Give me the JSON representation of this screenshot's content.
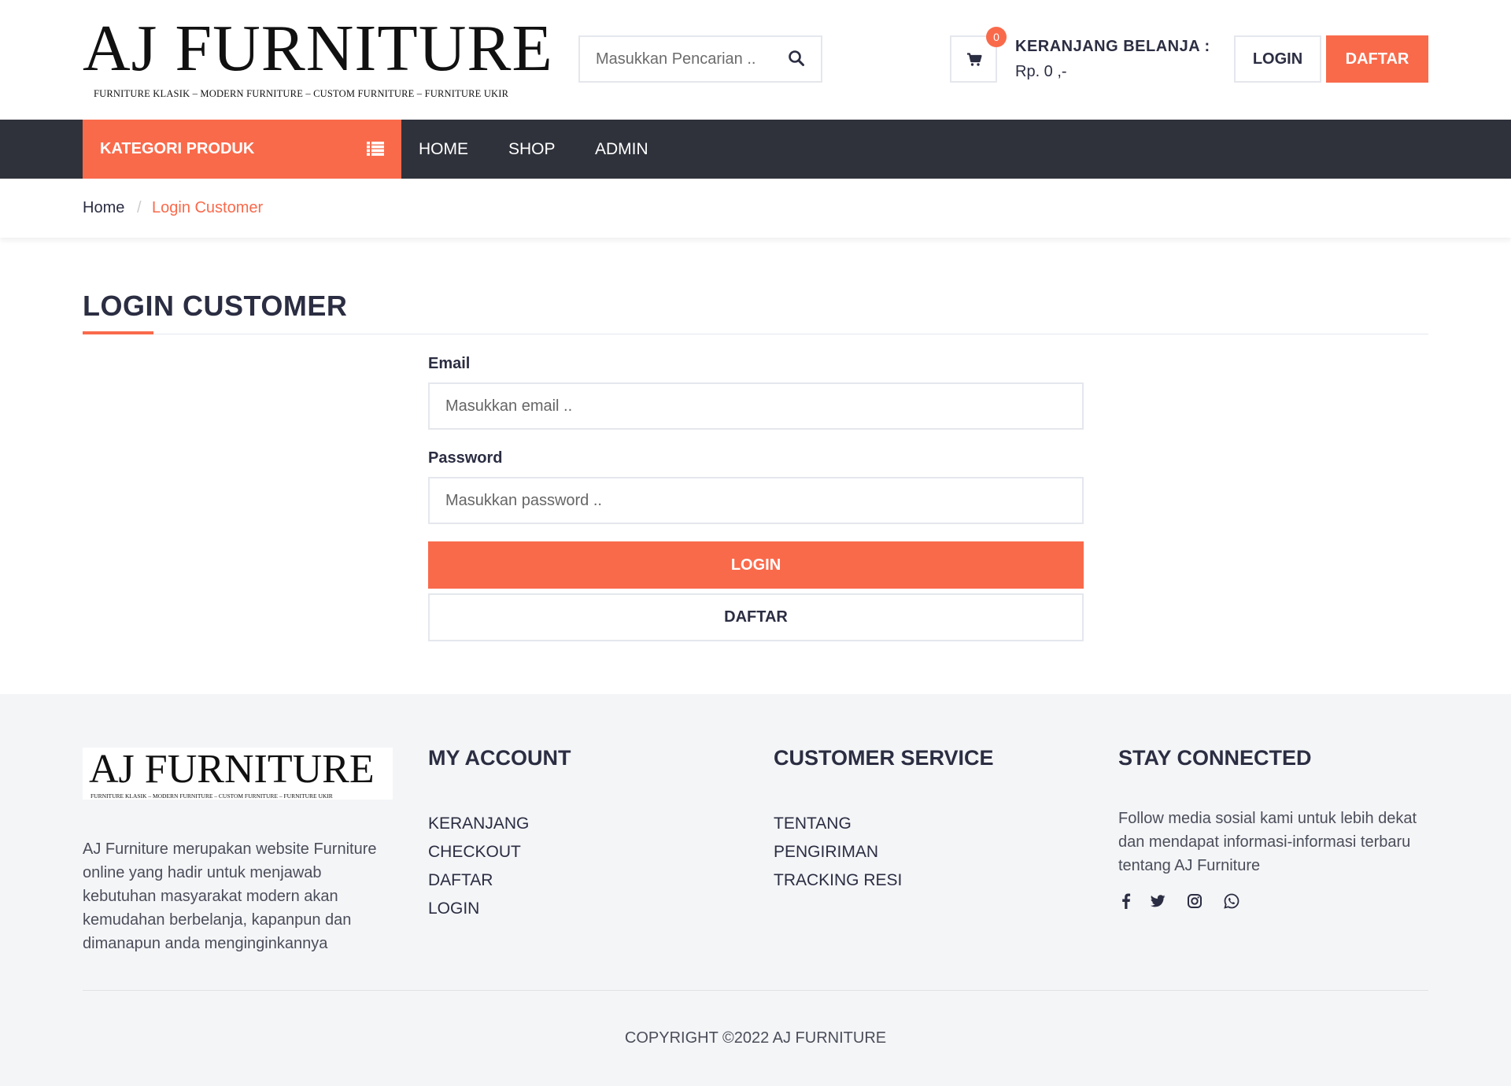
{
  "brand": {
    "name": "AJ FURNITURE",
    "tagline": "FURNITURE KLASIK – MODERN FURNITURE – CUSTOM FURNITURE – FURNITURE UKIR"
  },
  "header": {
    "search_placeholder": "Masukkan Pencarian ..",
    "cart_count": "0",
    "cart_title": "KERANJANG BELANJA :",
    "cart_total": "Rp. 0 ,-",
    "login_label": "LOGIN",
    "daftar_label": "DAFTAR"
  },
  "nav": {
    "category_label": "KATEGORI PRODUK",
    "items": [
      {
        "label": "HOME"
      },
      {
        "label": "SHOP"
      },
      {
        "label": "ADMIN"
      }
    ]
  },
  "breadcrumb": {
    "home": "Home",
    "separator": "/",
    "current": "Login Customer"
  },
  "page": {
    "title": "LOGIN CUSTOMER"
  },
  "form": {
    "email_label": "Email",
    "email_placeholder": "Masukkan email ..",
    "email_value": "",
    "password_label": "Password",
    "password_placeholder": "Masukkan password ..",
    "password_value": "",
    "login_button": "LOGIN",
    "daftar_button": "DAFTAR"
  },
  "footer": {
    "about": "AJ Furniture merupakan website Furniture online yang hadir untuk menjawab kebutuhan masyarakat modern akan kemudahan berbelanja, kapanpun dan dimanapun anda menginginkannya",
    "my_account": {
      "title": "MY ACCOUNT",
      "links": [
        "KERANJANG",
        "CHECKOUT",
        "DAFTAR",
        "LOGIN"
      ]
    },
    "customer_service": {
      "title": "CUSTOMER SERVICE",
      "links": [
        "TENTANG",
        "PENGIRIMAN",
        "TRACKING RESI"
      ]
    },
    "stay_connected": {
      "title": "STAY CONNECTED",
      "text": "Follow media sosial kami untuk lebih dekat dan mendapat informasi-informasi terbaru tentang AJ Furniture",
      "icons": [
        "facebook-icon",
        "twitter-icon",
        "instagram-icon",
        "whatsapp-icon"
      ]
    },
    "copyright": "COPYRIGHT ©2022 AJ FURNITURE"
  },
  "colors": {
    "accent": "#f96a4b",
    "nav_bg": "#2f323b",
    "text_dark": "#2b2d42",
    "footer_bg": "#f4f5f7"
  }
}
